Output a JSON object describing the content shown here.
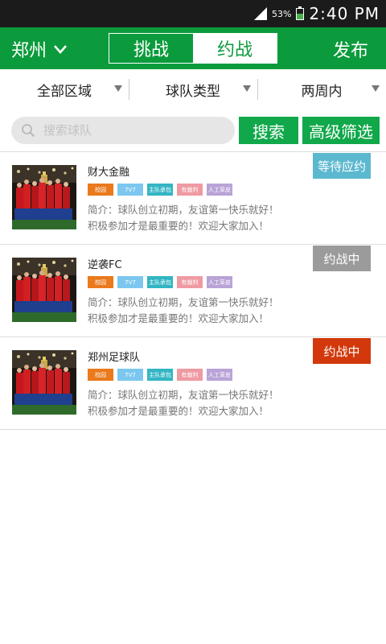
{
  "status_bar": {
    "battery": "53%",
    "battery_level": 0.53,
    "time": "2:40 PM"
  },
  "header": {
    "city": "郑州",
    "tabs": [
      {
        "label": "挑战",
        "active": false
      },
      {
        "label": "约战",
        "active": true
      }
    ],
    "publish": "发布"
  },
  "filters": [
    {
      "label": "全部区域"
    },
    {
      "label": "球队类型"
    },
    {
      "label": "两周内"
    }
  ],
  "search": {
    "placeholder": "搜索球队",
    "value": "",
    "search_label": "搜索",
    "advanced_label": "高级筛选"
  },
  "teams": [
    {
      "name": "财大金融",
      "tags": [
        "校园",
        "7V7",
        "主队承包",
        "有裁判",
        "人工草皮"
      ],
      "desc1": "简介：球队创立初期，友谊第一快乐就好！",
      "desc2": "积极参加才是最重要的！欢迎大家加入！",
      "status": "等待应约",
      "status_color": "#5bb8cf"
    },
    {
      "name": "逆袭FC",
      "tags": [
        "校园",
        "7V7",
        "主队承包",
        "有裁判",
        "人工草皮"
      ],
      "desc1": "简介：球队创立初期，友谊第一快乐就好！",
      "desc2": "积极参加才是最重要的！欢迎大家加入！",
      "status": "约战中",
      "status_color": "#9b9b9b"
    },
    {
      "name": "郑州足球队",
      "tags": [
        "校园",
        "7V7",
        "主队承包",
        "有裁判",
        "人工草皮"
      ],
      "desc1": "简介：球队创立初期，友谊第一快乐就好！",
      "desc2": "积极参加才是最重要的！欢迎大家加入！",
      "status": "约战中",
      "status_color": "#d2380b"
    }
  ],
  "tag_colors": [
    "#ea7a1c",
    "#7cc7ef",
    "#33b5c4",
    "#ef9aa3",
    "#b9a3d6"
  ],
  "colors": {
    "primary": "#0b9b3c",
    "button": "#10a84a",
    "statusbar": "#1b1b1b"
  }
}
